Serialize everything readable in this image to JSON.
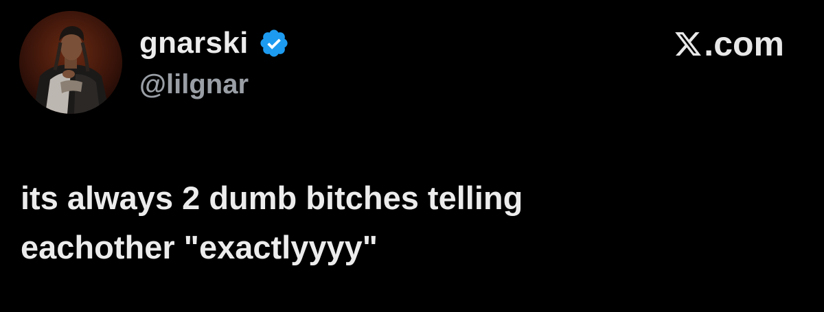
{
  "author": {
    "display_name": "gnarski",
    "handle": "@lilgnar",
    "verified": true,
    "verified_color": "#1d9bf0"
  },
  "brand": {
    "label": ".com",
    "icon": "x-logo-icon"
  },
  "tweet": {
    "lines": [
      "its always 2 dumb bitches telling",
      "eachother \"exactlyyyy\""
    ]
  },
  "colors": {
    "background": "#000000",
    "text": "#ececec",
    "handle": "#9a9fa6"
  }
}
